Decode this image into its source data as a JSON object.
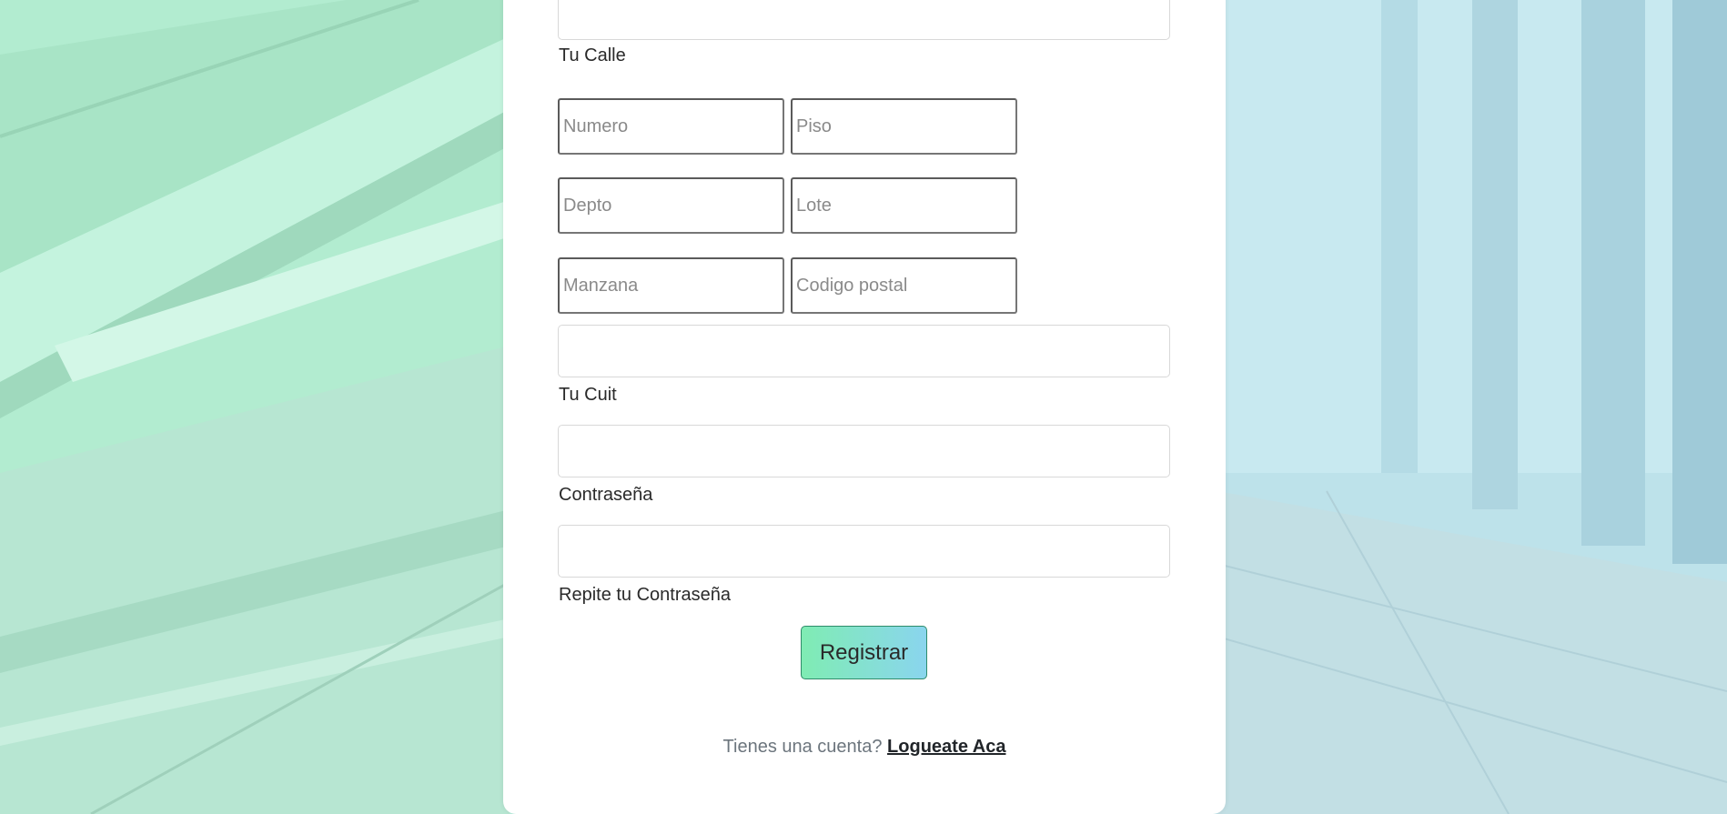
{
  "form": {
    "street_label": "Tu Calle",
    "numero_placeholder": "Numero",
    "piso_placeholder": "Piso",
    "depto_placeholder": "Depto",
    "lote_placeholder": "Lote",
    "manzana_placeholder": "Manzana",
    "codigo_postal_placeholder": "Codigo postal",
    "cuit_label": "Tu Cuit",
    "password_label": "Contraseña",
    "repeat_password_label": "Repite tu Contraseña",
    "submit_label": "Registrar"
  },
  "footer": {
    "prompt": "Tienes una cuenta?",
    "login_link": "Logueate Aca"
  },
  "colors": {
    "button_gradient_start": "#7fecb3",
    "button_gradient_end": "#8ad5ee",
    "background_tint": "#b8eedd"
  }
}
